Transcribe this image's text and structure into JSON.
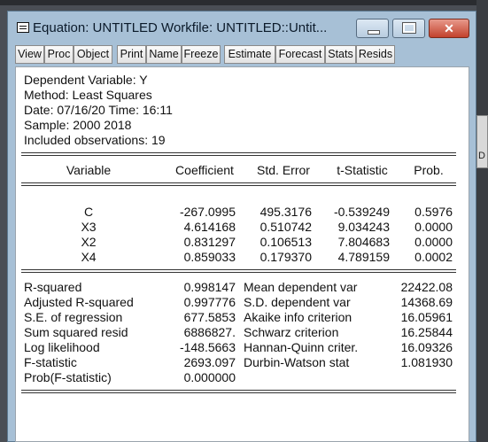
{
  "window": {
    "title": "Equation: UNTITLED   Workfile: UNTITLED::Untit...",
    "controls": {
      "minimize": "–",
      "maximize": "□",
      "close": "✕"
    }
  },
  "toolbar": [
    "View",
    "Proc",
    "Object",
    "Print",
    "Name",
    "Freeze",
    "Estimate",
    "Forecast",
    "Stats",
    "Resids"
  ],
  "header": {
    "dependent": "Dependent Variable: Y",
    "method": "Method: Least Squares",
    "date": "Date: 07/16/20   Time: 16:11",
    "sample": "Sample: 2000 2018",
    "obs": "Included observations: 19"
  },
  "coef_table": {
    "columns": [
      "Variable",
      "Coefficient",
      "Std. Error",
      "t-Statistic",
      "Prob."
    ],
    "rows": [
      [
        "C",
        "-267.0995",
        "495.3176",
        "-0.539249",
        "0.5976"
      ],
      [
        "X3",
        "4.614168",
        "0.510742",
        "9.034243",
        "0.0000"
      ],
      [
        "X2",
        "0.831297",
        "0.106513",
        "7.804683",
        "0.0000"
      ],
      [
        "X4",
        "0.859033",
        "0.179370",
        "4.789159",
        "0.0002"
      ]
    ]
  },
  "stats": {
    "left": [
      [
        "R-squared",
        "0.998147"
      ],
      [
        "Adjusted R-squared",
        "0.997776"
      ],
      [
        "S.E. of regression",
        "677.5853"
      ],
      [
        "Sum squared resid",
        "6886827."
      ],
      [
        "Log likelihood",
        "-148.5663"
      ],
      [
        "F-statistic",
        "2693.097"
      ],
      [
        "Prob(F-statistic)",
        "0.000000"
      ]
    ],
    "right": [
      [
        "Mean dependent var",
        "22422.08"
      ],
      [
        "S.D. dependent var",
        "14368.69"
      ],
      [
        "Akaike info criterion",
        "16.05961"
      ],
      [
        "Schwarz criterion",
        "16.25844"
      ],
      [
        "Hannan-Quinn criter.",
        "16.09326"
      ],
      [
        "Durbin-Watson stat",
        "1.081930"
      ]
    ]
  },
  "background": {
    "fragment_letter": "D"
  }
}
